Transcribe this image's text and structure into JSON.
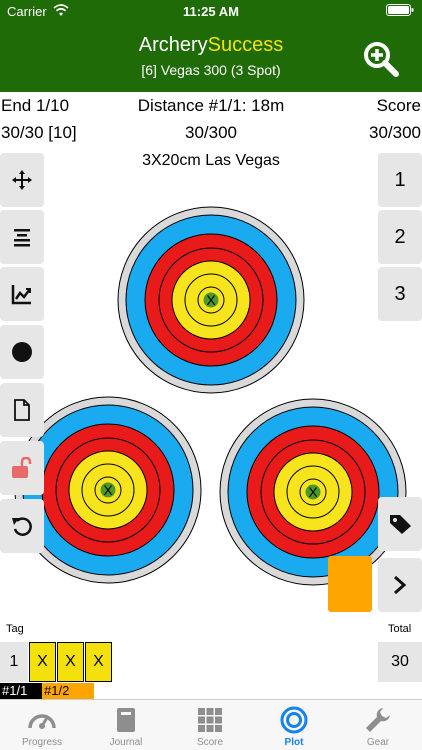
{
  "status_bar": {
    "carrier": "Carrier",
    "time": "11:25 AM"
  },
  "header": {
    "title_part1": "Archery",
    "title_part2": "Success",
    "subtitle": "[6] Vegas 300 (3 Spot)",
    "title_color": "#ffffff",
    "title_accent_color": "#f4e10c",
    "background_color": "#1f6b08",
    "zoom_icon": "zoom-in-icon"
  },
  "info": {
    "end_label": "End 1/10",
    "distance_label": "Distance #1/1: 18m",
    "score_label": "Score",
    "end_score": "30/30 [10]",
    "distance_score": "30/300",
    "total_score": "30/300"
  },
  "target": {
    "title": "3X20cm Las Vegas",
    "colors": {
      "outer_ring": "#d9d9d9",
      "blue": "#19aaf0",
      "red": "#e81a1a",
      "yellow": "#f7e41d",
      "x_mark": "#2e8b2e"
    }
  },
  "tools": [
    {
      "name": "move-icon"
    },
    {
      "name": "align-icon"
    },
    {
      "name": "chart-icon"
    },
    {
      "name": "dot-icon"
    },
    {
      "name": "document-icon"
    },
    {
      "name": "unlock-icon"
    },
    {
      "name": "undo-icon"
    }
  ],
  "end_buttons": [
    {
      "label": "1"
    },
    {
      "label": "2"
    },
    {
      "label": "3"
    }
  ],
  "actions": {
    "tag_icon": "tag-icon",
    "next_icon": "chevron-right-icon",
    "swatch_color": "#ffa500"
  },
  "tag_area": {
    "tag_label": "Tag",
    "total_label": "Total",
    "arrow_index": "1",
    "arrows": [
      "X",
      "X",
      "X"
    ],
    "total": "30",
    "plot_tags": [
      "#1/1",
      "#1/2"
    ]
  },
  "tabs": [
    {
      "label": "Progress",
      "icon": "gauge-icon",
      "active": false
    },
    {
      "label": "Journal",
      "icon": "journal-icon",
      "active": false
    },
    {
      "label": "Score",
      "icon": "grid-icon",
      "active": false
    },
    {
      "label": "Plot",
      "icon": "target-icon",
      "active": true
    },
    {
      "label": "Gear",
      "icon": "wrench-icon",
      "active": false
    }
  ]
}
